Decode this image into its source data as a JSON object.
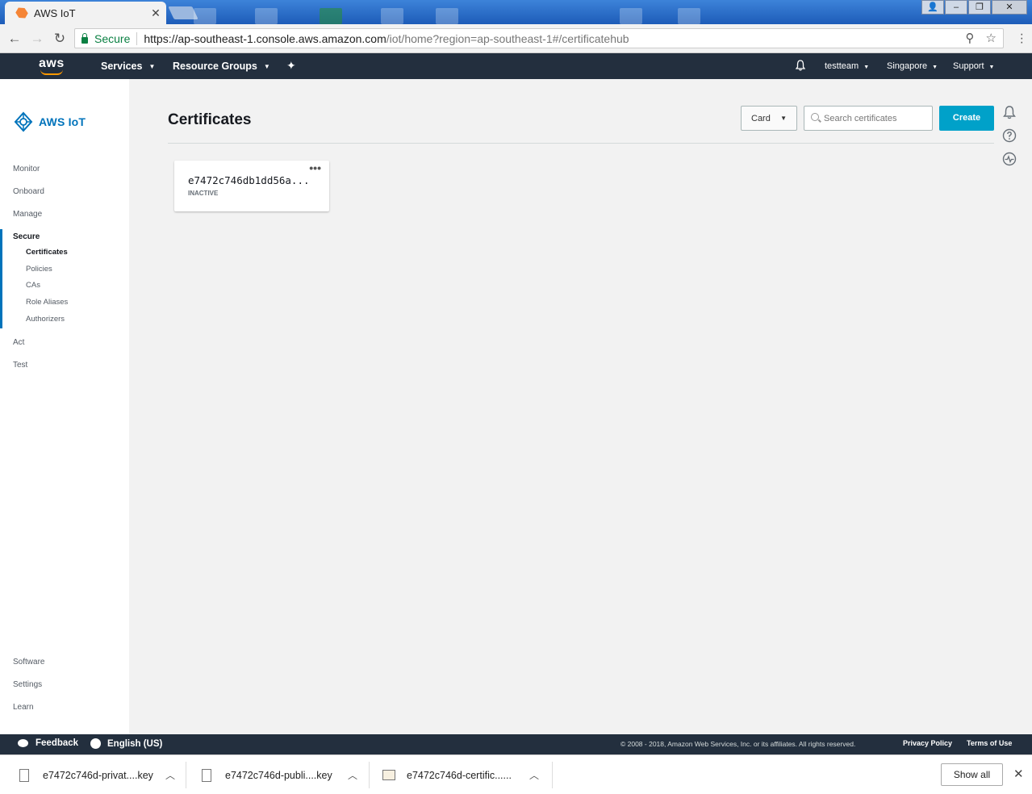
{
  "browser": {
    "tab_title": "AWS IoT",
    "tab_close": "✕",
    "secure_label": "Secure",
    "url_host": "https://ap-southeast-1.console.aws.amazon.com",
    "url_path": "/iot/home?region=ap-southeast-1#/certificatehub"
  },
  "awsnav": {
    "logo": "aws",
    "services": "Services",
    "resource_groups": "Resource Groups",
    "account": "testteam",
    "region": "Singapore",
    "support": "Support"
  },
  "sidebar": {
    "brand": "AWS IoT",
    "items": [
      {
        "label": "Monitor"
      },
      {
        "label": "Onboard"
      },
      {
        "label": "Manage"
      },
      {
        "label": "Secure"
      },
      {
        "label": "Act"
      },
      {
        "label": "Test"
      }
    ],
    "secure_sub": [
      {
        "label": "Certificates"
      },
      {
        "label": "Policies"
      },
      {
        "label": "CAs"
      },
      {
        "label": "Role Aliases"
      },
      {
        "label": "Authorizers"
      }
    ],
    "bottom": [
      {
        "label": "Software"
      },
      {
        "label": "Settings"
      },
      {
        "label": "Learn"
      }
    ]
  },
  "main": {
    "title": "Certificates",
    "view_mode": "Card",
    "search_placeholder": "Search certificates",
    "create_label": "Create",
    "cards": [
      {
        "id": "e7472c746db1dd56a...",
        "status": "INACTIVE",
        "more": "•••"
      }
    ]
  },
  "footer": {
    "feedback": "Feedback",
    "language": "English (US)",
    "copyright": "© 2008 - 2018, Amazon Web Services, Inc. or its affiliates. All rights reserved.",
    "privacy": "Privacy Policy",
    "terms": "Terms of Use"
  },
  "downloads": {
    "files": [
      {
        "name": "e7472c746d-privat....key"
      },
      {
        "name": "e7472c746d-publi....key"
      },
      {
        "name": "e7472c746d-certific......"
      }
    ],
    "show_all": "Show all"
  },
  "colors": {
    "aws_nav": "#232f3e",
    "accent_blue": "#0073bb",
    "create_button": "#00a1c9",
    "aws_orange": "#ff9900"
  }
}
